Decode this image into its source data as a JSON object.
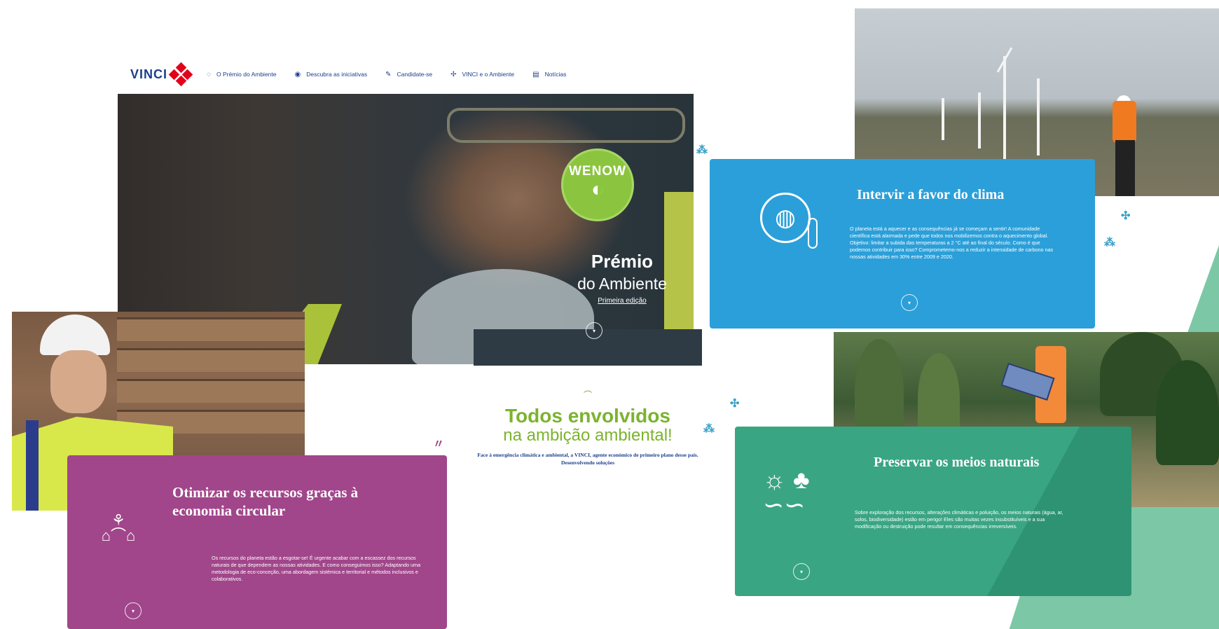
{
  "nav": {
    "logo_text": "VINCI",
    "items": [
      {
        "label": "O Prémio do Ambiente",
        "icon": "lightbulb-icon"
      },
      {
        "label": "Descubra as iniciativas",
        "icon": "eye-icon"
      },
      {
        "label": "Candidate-se",
        "icon": "megaphone-icon"
      },
      {
        "label": "VINCI e o Ambiente",
        "icon": "turbine-icon"
      },
      {
        "label": "Notícias",
        "icon": "news-icon"
      }
    ]
  },
  "hero": {
    "badge": "WENOW",
    "title_line1": "Prémio",
    "title_line2": "do Ambiente",
    "edition": "Primeira edição"
  },
  "todos": {
    "line1": "Todos envolvidos",
    "line2": "na ambição ambiental!",
    "body": "Face à emergência climática e ambiental, a VINCI, agente económico de primeiro plano desse país. Desenvolvendo soluções"
  },
  "cards": {
    "purple": {
      "title": "Otimizar os recursos graças à economia circular",
      "text": "Os recursos do planeta estão a esgotar-se! É urgente acabar com a escassez dos recursos naturais de que dependem as nossas atividades. E como conseguimos isso? Adaptando uma metodologia de eco-conceção, uma abordagem sistémica e territorial e métodos inclusivos e colaborativos.",
      "icon": "recycle-plant-icon",
      "color": "#a1468a"
    },
    "blue": {
      "title": "Intervir a favor do clima",
      "text": "O planeta está a aquecer e as consequências já se começam a sentir! A comunidade científica está alarmada e pede que todos nos mobilizemos contra o aquecimento global. Objetivo: limitar a subida das temperaturas a 2 °C até ao final do século. Como é que podemos contribuir para isso? Comprometemo-nos a reduzir a intensidade de carbono nas nossas atividades em 30% entre 2009 e 2020.",
      "icon": "globe-thermometer-icon",
      "color": "#2b9fd9"
    },
    "green": {
      "title": "Preservar os meios naturais",
      "text": "Sobre exploração dos recursos, alterações climáticas e poluição, os meios naturais (água, ar, solos, biodiversidade) estão em perigo! Eles são muitas vezes insubstituíveis e a sua modificação ou destruição pode resultar em consequências irreversíveis.",
      "icon": "nature-landscape-icon",
      "color": "#3aa582"
    }
  }
}
